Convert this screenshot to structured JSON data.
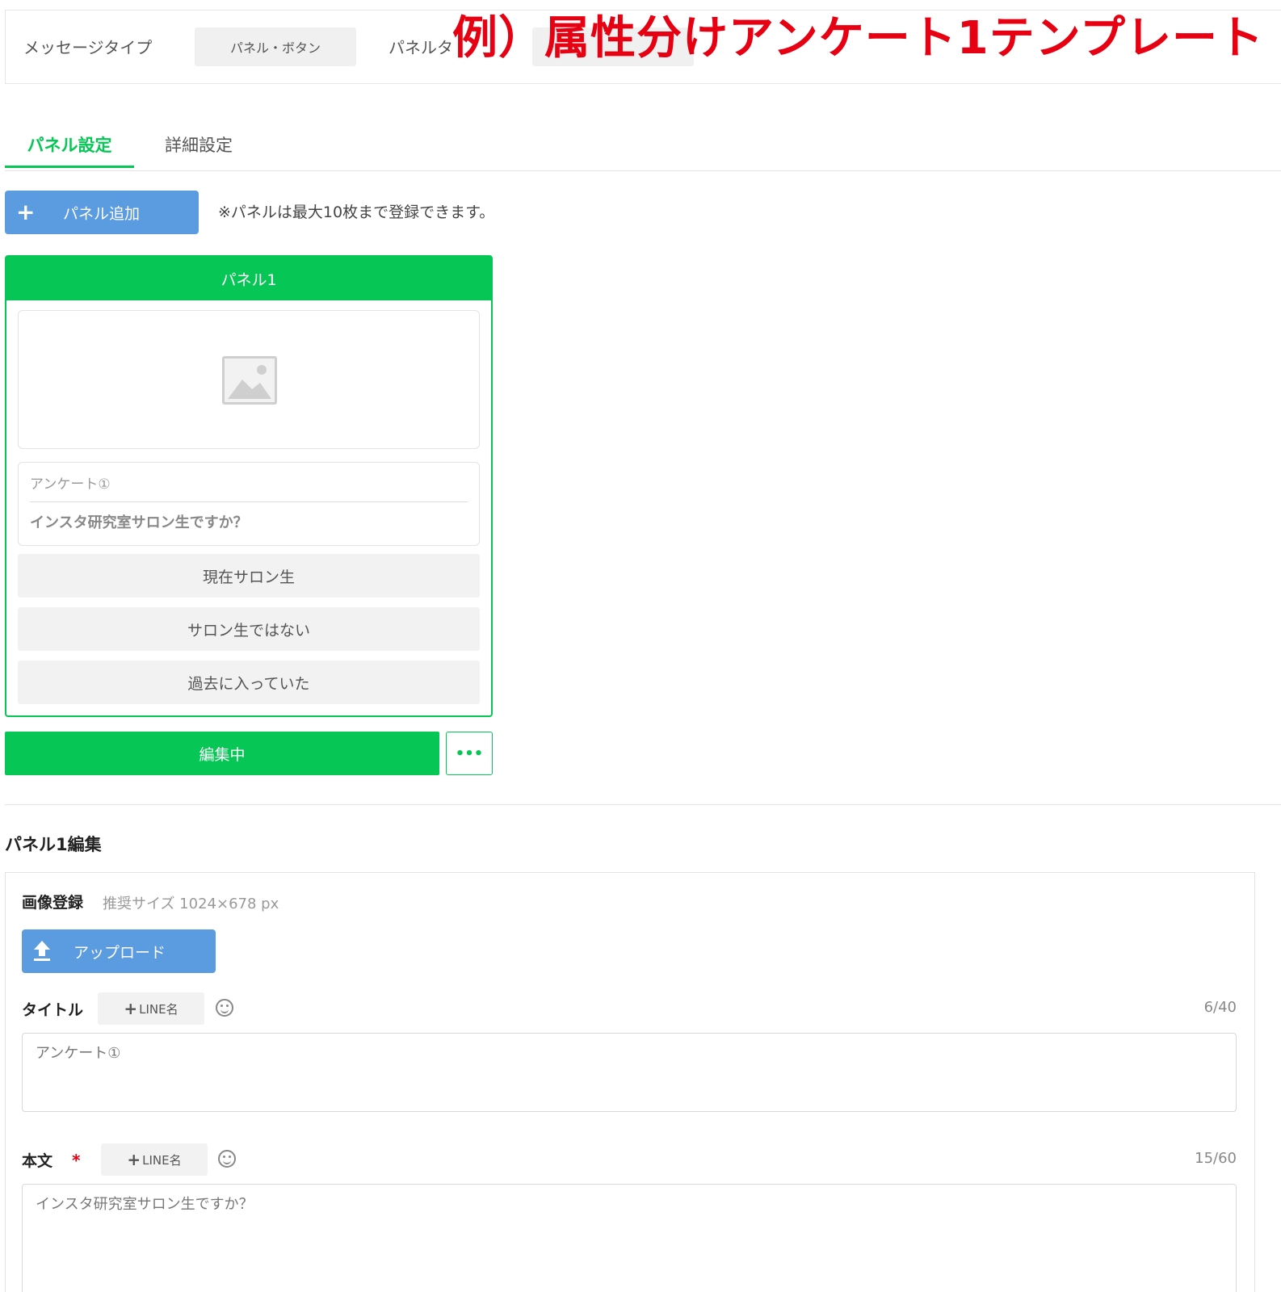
{
  "header": {
    "message_type_label": "メッセージタイプ",
    "message_type_value": "パネル・ボタン",
    "panel_type_label": "パネルタ",
    "overlay_title": "例）属性分けアンケート1テンプレート"
  },
  "tabs": [
    {
      "label": "パネル設定",
      "active": true
    },
    {
      "label": "詳細設定",
      "active": false
    }
  ],
  "toolbar": {
    "add_panel_label": "パネル追加",
    "add_panel_icon": "plus-icon",
    "note": "※パネルは最大10枚まで登録できます。"
  },
  "panel_preview": {
    "header": "パネル1",
    "image_icon": "image-placeholder-icon",
    "title": "アンケート①",
    "body": "インスタ研究室サロン生ですか？",
    "choices": [
      "現在サロン生",
      "サロン生ではない",
      "過去に入っていた"
    ],
    "editing_label": "編集中",
    "more_label": "•••"
  },
  "edit": {
    "heading": "パネル1編集",
    "image_label": "画像登録",
    "image_hint": "推奨サイズ 1024×678 px",
    "upload_label": "アップロード",
    "upload_icon": "upload-icon",
    "title_label": "タイトル",
    "title_line_name": "LINE名",
    "title_counter": "6/40",
    "title_value": "アンケート①",
    "body_label": "本文",
    "body_required": "*",
    "body_line_name": "LINE名",
    "body_counter": "15/60",
    "body_value": "インスタ研究室サロン生ですか？"
  },
  "colors": {
    "accent_green": "#06c755",
    "button_blue": "#5b9bdf",
    "overlay_red": "#e60012"
  }
}
